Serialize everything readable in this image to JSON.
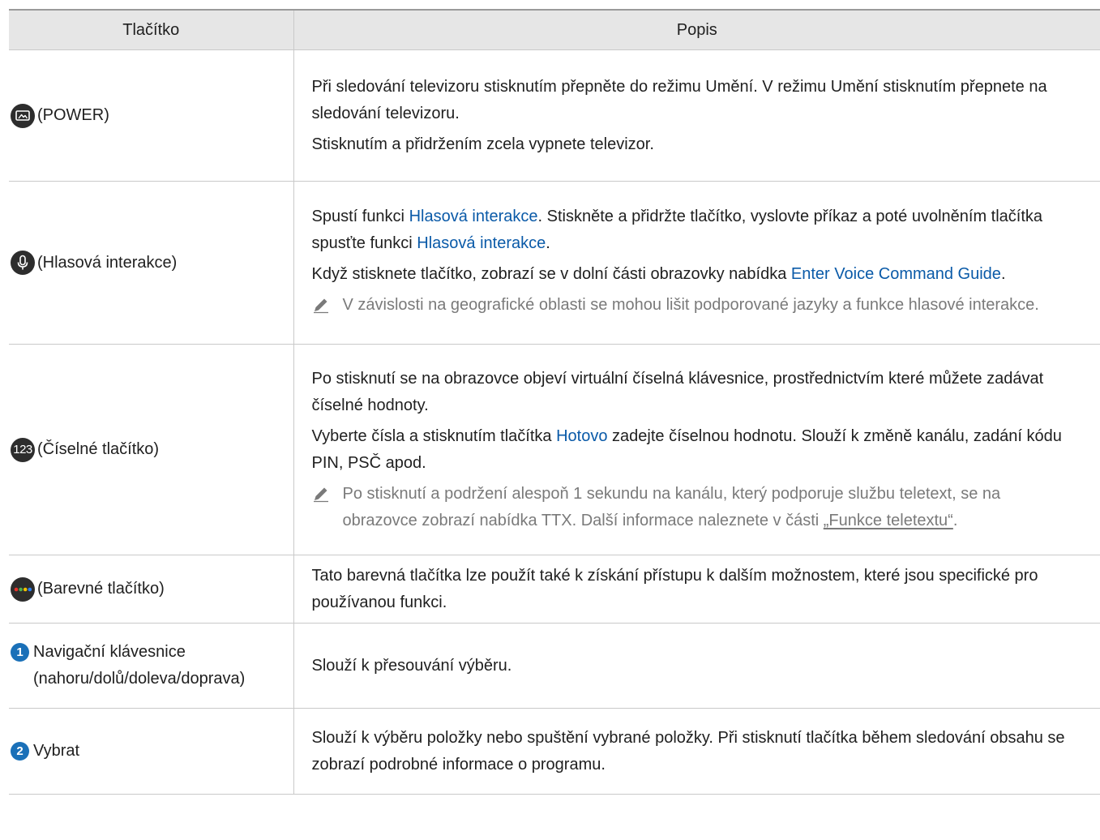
{
  "table": {
    "headers": {
      "key": "Tlačítko",
      "description": "Popis"
    },
    "rows": [
      {
        "icon": "art-mode-power-icon",
        "key_label": "(POWER)",
        "paragraphs": [
          "Při sledování televizoru stisknutím přepněte do režimu Umění. V režimu Umění stisknutím přepnete na sledování televizoru.",
          "Stisknutím a přidržením zcela vypnete televizor."
        ]
      },
      {
        "icon": "microphone-icon",
        "key_label": "(Hlasová interakce)",
        "p1": {
          "before": "Spustí funkci ",
          "link1": "Hlasová interakce",
          "middle": ". Stiskněte a přidržte tlačítko, vyslovte příkaz a poté uvolněním tlačítka spusťte funkci ",
          "link2": "Hlasová interakce",
          "after": "."
        },
        "p2": {
          "before": "Když stisknete tlačítko, zobrazí se v dolní části obrazovky nabídka ",
          "link": "Enter Voice Command Guide",
          "after": "."
        },
        "note": "V závislosti na geografické oblasti se mohou lišit podporované jazyky a funkce hlasové interakce."
      },
      {
        "icon": "numeric-123-icon",
        "icon_text": "123",
        "key_label": "(Číselné tlačítko)",
        "p1": "Po stisknutí se na obrazovce objeví virtuální číselná klávesnice, prostřednictvím které můžete zadávat číselné hodnoty.",
        "p2": {
          "before": "Vyberte čísla a stisknutím tlačítka ",
          "link": "Hotovo",
          "after": " zadejte číselnou hodnotu. Slouží k změně kanálu, zadání kódu PIN, PSČ apod."
        },
        "note": {
          "before": "Po stisknutí a podržení alespoň 1 sekundu na kanálu, který podporuje službu teletext, se na obrazovce zobrazí nabídka TTX. Další informace naleznete v části ",
          "ref": "„Funkce teletextu“",
          "after": "."
        }
      },
      {
        "icon": "color-dots-icon",
        "key_label": "(Barevné tlačítko)",
        "paragraph": "Tato barevná tlačítka lze použít také k získání přístupu k dalším možnostem, které jsou specifické pro používanou funkci."
      },
      {
        "marker": "1",
        "key_label": "Navigační klávesnice (nahoru/dolů/doleva/doprava)",
        "paragraph": "Slouží k přesouvání výběru."
      },
      {
        "marker": "2",
        "key_label": "Vybrat",
        "paragraph": "Slouží k výběru položky nebo spuštění vybrané položky. Při stisknutí tlačítka během sledování obsahu se zobrazí podrobné informace o programu."
      }
    ]
  },
  "colors": {
    "header_bg": "#e6e6e6",
    "link": "#0a5aa8",
    "note_text": "#7a7a7a",
    "marker": "#1a70b8",
    "icon_bg": "#2d2d2d",
    "dot_red": "#e8322b",
    "dot_green": "#4caf50",
    "dot_yellow": "#f2c200",
    "dot_blue": "#2d7ff0"
  }
}
